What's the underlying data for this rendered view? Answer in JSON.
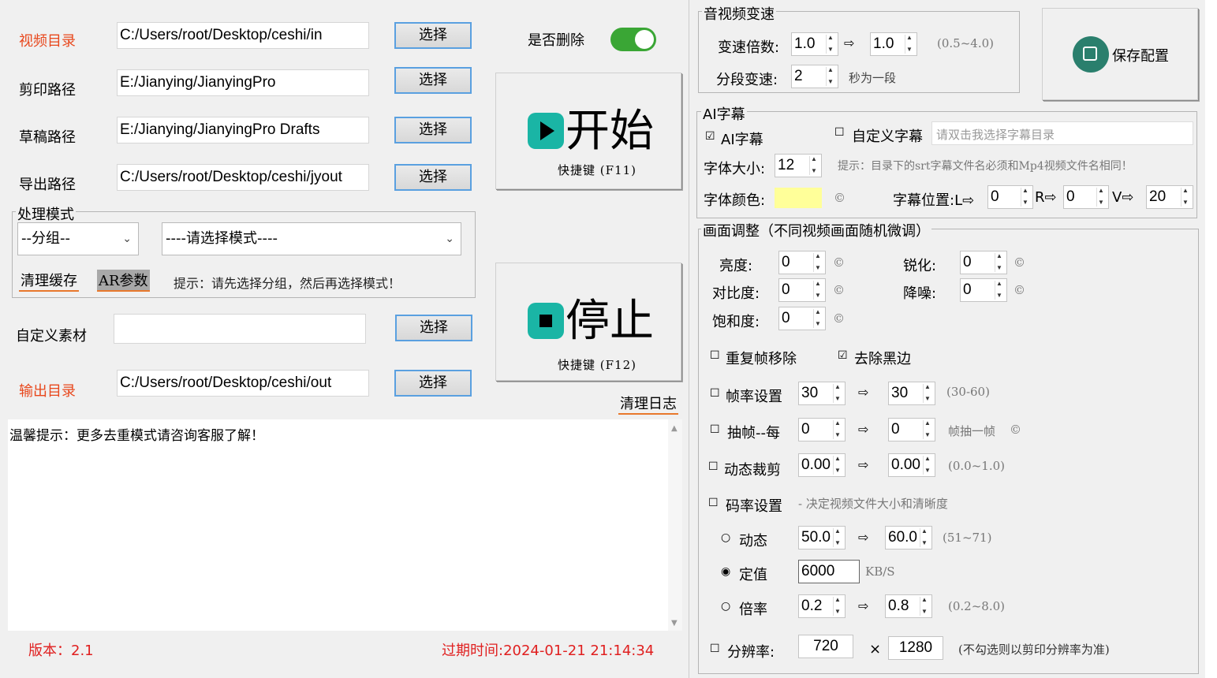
{
  "left": {
    "video_dir": {
      "label": "视频目录",
      "value": "C:/Users/root/Desktop/ceshi/in",
      "button": "选择"
    },
    "jianying_path": {
      "label": "剪印路径",
      "value": "E:/Jianying/JianyingPro",
      "button": "选择"
    },
    "draft_path": {
      "label": "草稿路径",
      "value": "E:/Jianying/JianyingPro Drafts",
      "button": "选择"
    },
    "export_path": {
      "label": "导出路径",
      "value": "C:/Users/root/Desktop/ceshi/jyout",
      "button": "选择"
    },
    "delete_toggle": {
      "label": "是否删除",
      "on": true
    },
    "mode": {
      "title": "处理模式",
      "group_select": "--分组--",
      "mode_select": "----请选择模式----",
      "clear_cache": "清理缓存",
      "ar_params": "AR参数",
      "tip": "提示：请先选择分组，然后再选择模式！"
    },
    "custom_material": {
      "label": "自定义素材",
      "value": "",
      "button": "选择"
    },
    "output_dir": {
      "label": "输出目录",
      "value": "C:/Users/root/Desktop/ceshi/out",
      "button": "选择"
    },
    "start": {
      "label": "开始",
      "hotkey": "快捷键 (F11)"
    },
    "stop": {
      "label": "停止",
      "hotkey": "快捷键 (F12)"
    },
    "clear_log": "清理日志",
    "log_text": "温馨提示：更多去重模式请咨询客服了解！",
    "version": "版本：2.1",
    "expiry": "过期时间:2024-01-21 21:14:34"
  },
  "right": {
    "speed": {
      "title": "音视频变速",
      "ratio_label": "变速倍数:",
      "ratio_from": "1.0",
      "ratio_to": "1.0",
      "ratio_hint": "(0.5~4.0)",
      "segment_label": "分段变速:",
      "segment_value": "2",
      "segment_hint": "秒为一段"
    },
    "save_config": "保存配置",
    "subtitle": {
      "title": "AI字幕",
      "ai_label": "AI字幕",
      "ai_checked": true,
      "custom_label": "自定义字幕",
      "custom_checked": false,
      "custom_placeholder": "请双击我选择字幕目录",
      "font_size_label": "字体大小:",
      "font_size": "12",
      "note": "提示：目录下的srt字幕文件名必须和Mp4视频文件名相同！",
      "color_label": "字体颜色:",
      "color": "#ffff99",
      "copyright": "©",
      "position_label": "字幕位置:L⇨",
      "l_value": "0",
      "r_label": "R⇨",
      "r_value": "0",
      "v_label": "V⇨",
      "v_value": "20"
    },
    "picture": {
      "title": "画面调整（不同视频画面随机微调）",
      "brightness_label": "亮度:",
      "brightness": "0",
      "sharpen_label": "锐化:",
      "sharpen": "0",
      "contrast_label": "对比度:",
      "contrast": "0",
      "denoise_label": "降噪:",
      "denoise": "0",
      "saturation_label": "饱和度:",
      "saturation": "0",
      "copyright": "©"
    },
    "options": {
      "dedup_frames": "重复帧移除",
      "dedup_checked": false,
      "remove_black": "去除黑边",
      "remove_black_checked": true,
      "fps_label": "帧率设置",
      "fps_from": "30",
      "fps_to": "30",
      "fps_hint": "(30-60)",
      "extract_label": "抽帧--每",
      "extract_from": "0",
      "extract_to": "0",
      "extract_hint": "帧抽一帧",
      "crop_label": "动态裁剪",
      "crop_from": "0.00",
      "crop_to": "0.00",
      "crop_hint": "(0.0~1.0)",
      "bitrate_label": "码率设置",
      "bitrate_hint": "- 决定视频文件大小和清晰度",
      "dynamic_label": "动态",
      "dynamic_from": "50.0",
      "dynamic_to": "60.0",
      "dynamic_hint": "(51~71)",
      "fixed_label": "定值",
      "fixed_value": "6000",
      "fixed_unit": "KB/S",
      "multiplier_label": "倍率",
      "multiplier_from": "0.2",
      "multiplier_to": "0.8",
      "multiplier_hint": "(0.2~8.0)",
      "resolution_label": "分辨率:",
      "res_w": "720",
      "res_x": "×",
      "res_h": "1280",
      "res_hint": "(不勾选则以剪印分辨率为准)"
    }
  },
  "icons": {
    "arrow": "⇨",
    "check": "☑",
    "uncheck": "☐",
    "radio_on": "◉",
    "radio_off": "○"
  },
  "colors": {
    "accent_red": "#e8471c",
    "teal": "#1ab5a5",
    "toggle_green": "#3aa635",
    "button_border": "#5aa0e0"
  }
}
